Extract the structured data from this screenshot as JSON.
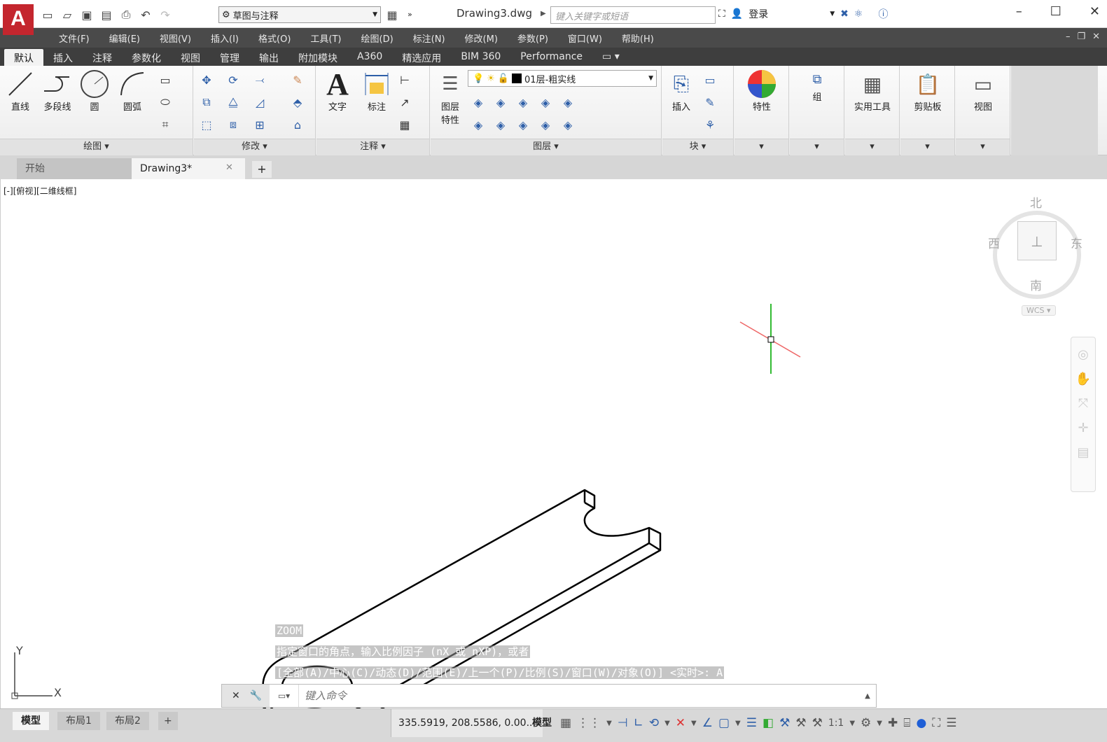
{
  "app": {
    "logo": "A",
    "doc_title": "Drawing3.dwg"
  },
  "qat": {
    "workspace": "草图与注释",
    "icons": [
      "new-icon",
      "open-icon",
      "save-icon",
      "saveas-icon",
      "print-icon",
      "undo-icon",
      "redo-icon"
    ]
  },
  "search": {
    "placeholder": "键入关键字或短语"
  },
  "account": {
    "login": "登录"
  },
  "menu": [
    "文件(F)",
    "编辑(E)",
    "视图(V)",
    "插入(I)",
    "格式(O)",
    "工具(T)",
    "绘图(D)",
    "标注(N)",
    "修改(M)",
    "参数(P)",
    "窗口(W)",
    "帮助(H)"
  ],
  "ribbon_tabs": [
    "默认",
    "插入",
    "注释",
    "参数化",
    "视图",
    "管理",
    "输出",
    "附加模块",
    "A360",
    "精选应用",
    "BIM 360",
    "Performance"
  ],
  "ribbon": {
    "draw": {
      "title": "绘图",
      "line": "直线",
      "polyline": "多段线",
      "circle": "圆",
      "arc": "圆弧"
    },
    "modify": {
      "title": "修改"
    },
    "annotation": {
      "title": "注释",
      "text": "文字",
      "dimension": "标注"
    },
    "layers": {
      "title": "图层",
      "props1": "图层",
      "props2": "特性",
      "current_layer": "01层-粗实线"
    },
    "block": {
      "title": "块",
      "insert": "插入"
    },
    "properties": {
      "label": "特性"
    },
    "group": {
      "label": "组"
    },
    "utilities": {
      "label": "实用工具"
    },
    "clipboard": {
      "label": "剪贴板"
    },
    "view": {
      "label": "视图"
    }
  },
  "file_tabs": {
    "start": "开始",
    "drawing": "Drawing3*"
  },
  "viewport": {
    "label": "[-][俯视][二维线框]"
  },
  "viewcube": {
    "north": "北",
    "south": "南",
    "east": "东",
    "west": "西",
    "wcs": "WCS"
  },
  "ucs": {
    "x": "X",
    "y": "Y"
  },
  "command_history": [
    "ZOOM",
    "指定窗口的角点，输入比例因子 (nX 或 nXP)，或者",
    "[全部(A)/中心(C)/动态(D)/范围(E)/上一个(P)/比例(S)/窗口(W)/对象(O)] <实时>: A"
  ],
  "command": {
    "placeholder": "键入命令"
  },
  "layout_tabs": {
    "model": "模型",
    "layout1": "布局1",
    "layout2": "布局2"
  },
  "status": {
    "coords": "335.5919, 208.5586, 0.00...",
    "model": "模型",
    "scale": "1:1"
  }
}
